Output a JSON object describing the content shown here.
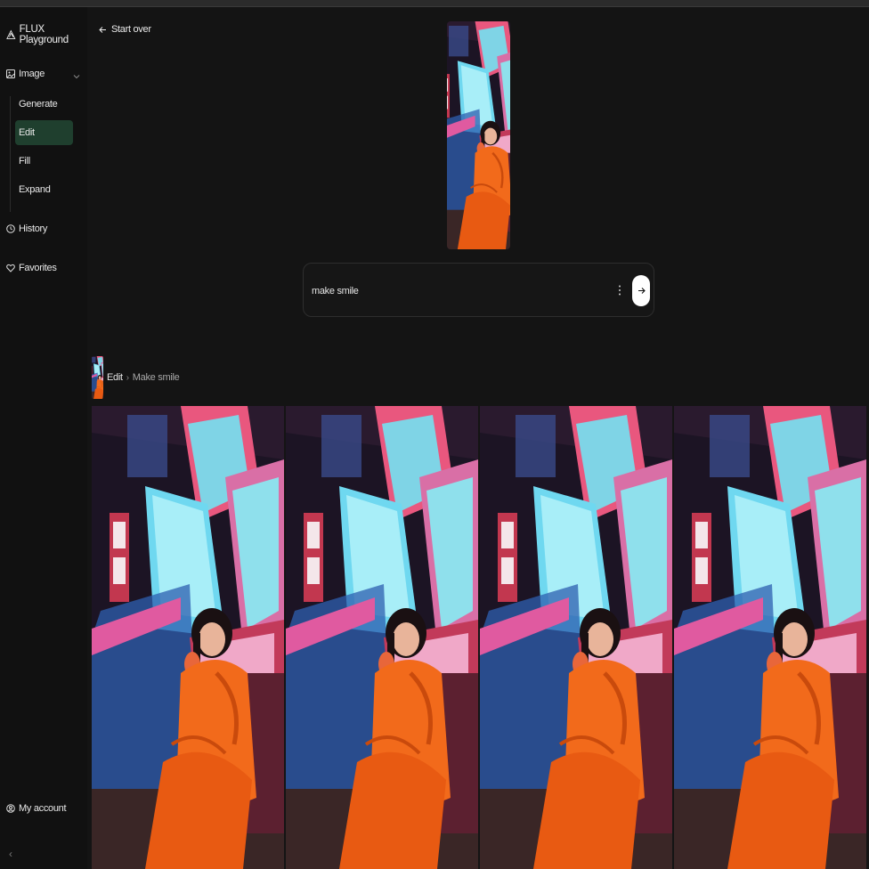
{
  "app": {
    "title": "FLUX Playground"
  },
  "sidebar": {
    "image_label": "Image",
    "sub_items": [
      {
        "label": "Generate"
      },
      {
        "label": "Edit",
        "active": true
      },
      {
        "label": "Fill"
      },
      {
        "label": "Expand"
      }
    ],
    "history_label": "History",
    "favorites_label": "Favorites",
    "account_label": "My account",
    "collapse_glyph": "‹"
  },
  "main": {
    "back_label": "Start over",
    "prompt": {
      "value": "make smile"
    },
    "breadcrumb": {
      "parent": "Edit",
      "separator": "›",
      "current": "Make smile"
    },
    "results_count_shown": 4
  },
  "colors": {
    "background": "#141414",
    "sidebar": "#111111",
    "active_item": "#1f3f2e",
    "send_button": "#ffffff"
  },
  "icons": [
    "flux-logo-icon",
    "image-icon",
    "chevron-down-icon",
    "history-icon",
    "heart-icon",
    "user-icon",
    "arrow-left-icon",
    "more-vertical-icon",
    "arrow-right-icon"
  ]
}
